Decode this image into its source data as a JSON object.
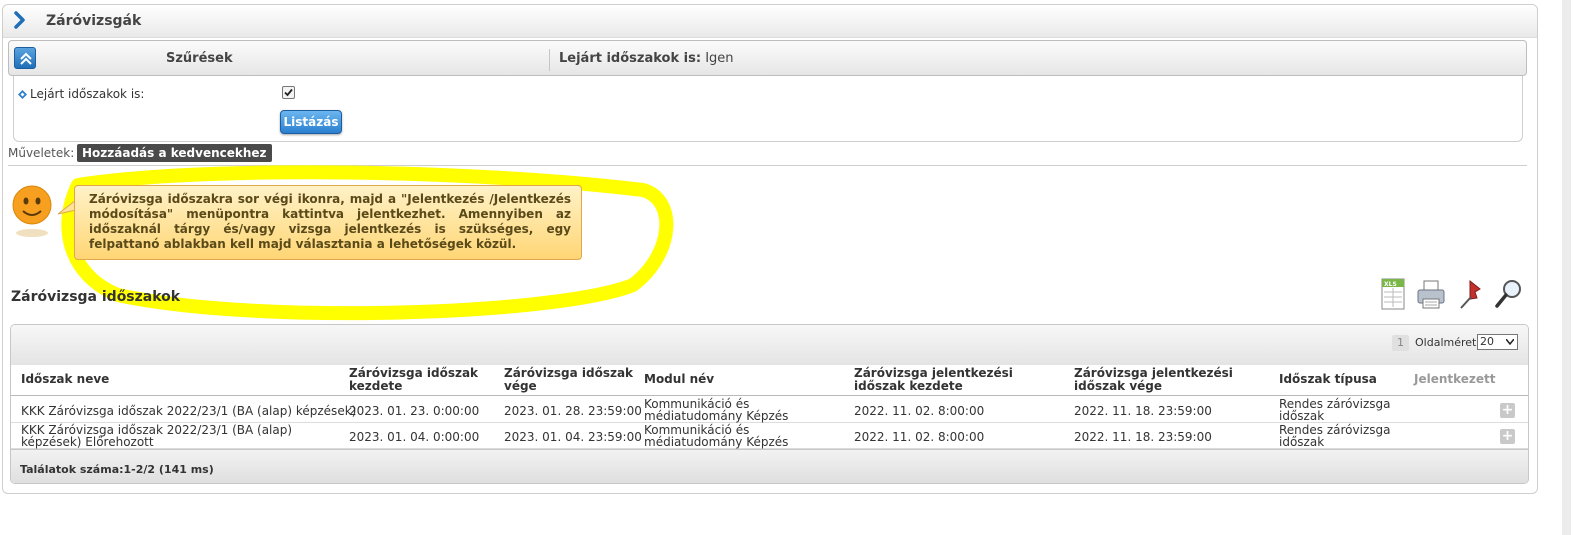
{
  "header": {
    "title": "Záróvizsgák"
  },
  "filter": {
    "label": "Szűrések",
    "summary_label": "Lejárt időszakok is:",
    "summary_value": "Igen",
    "lejart_label": "Lejárt időszakok is:",
    "lejart_checked": true,
    "list_button": "Listázás"
  },
  "actions": {
    "label": "Műveletek:",
    "favorite_button": "Hozzáadás a kedvencekhez"
  },
  "info_message": "Záróvizsga időszakra sor végi ikonra, majd a \"Jelentkezés /Jelentkezés módosítása\" menüpontra kattintva jelentkezhet. Amennyiben az időszaknál tárgy és/vagy vizsga jelentkezés is szükséges, egy felpattanó ablakban kell majd választania a lehetőségek közül.",
  "section": {
    "title": "Záróvizsga időszakok",
    "tools": [
      "xls-export-icon",
      "print-icon",
      "pin-icon",
      "search-icon"
    ]
  },
  "pager": {
    "page": "1",
    "page_size_label": "Oldalméret",
    "page_size": "20"
  },
  "table": {
    "columns": [
      "Időszak neve",
      "Záróvizsga időszak kezdete",
      "Záróvizsga időszak vége",
      "Modul név",
      "Záróvizsga jelentkezési időszak kezdete",
      "Záróvizsga jelentkezési időszak vége",
      "Időszak típusa",
      "Jelentkezett"
    ],
    "rows": [
      {
        "name": "KKK Záróvizsga időszak 2022/23/1 (BA (alap) képzések)",
        "start": "2023. 01. 23. 0:00:00",
        "end": "2023. 01. 28. 23:59:00",
        "module": "Kommunikáció és médiatudomány Képzés",
        "reg_start": "2022. 11. 02. 8:00:00",
        "reg_end": "2022. 11. 18. 23:59:00",
        "type": "Rendes záróvizsga időszak",
        "registered": ""
      },
      {
        "name": "KKK Záróvizsga időszak 2022/23/1 (BA (alap) képzések) Előrehozott",
        "start": "2023. 01. 04. 0:00:00",
        "end": "2023. 01. 04. 23:59:00",
        "module": "Kommunikáció és médiatudomány Képzés",
        "reg_start": "2022. 11. 02. 8:00:00",
        "reg_end": "2022. 11. 18. 23:59:00",
        "type": "Rendes záróvizsga időszak",
        "registered": ""
      }
    ]
  },
  "footer": {
    "results": "Találatok száma:1-2/2 (141 ms)"
  },
  "colors": {
    "accent": "#2a7fcf",
    "highlight": "#ffff00",
    "bubble": "#ffd675"
  }
}
